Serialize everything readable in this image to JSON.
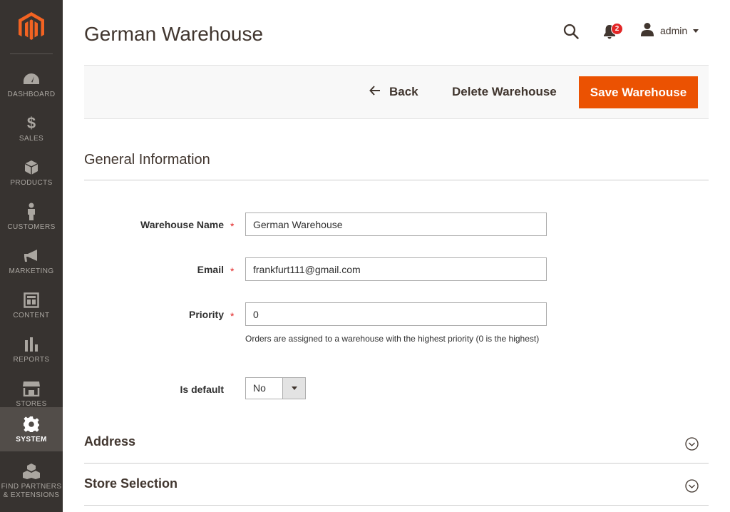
{
  "sidebar": {
    "logo_icon": "magento-logo-icon",
    "items": [
      {
        "label": "DASHBOARD",
        "icon": "dashboard-icon"
      },
      {
        "label": "SALES",
        "icon": "dollar-icon"
      },
      {
        "label": "PRODUCTS",
        "icon": "box-icon"
      },
      {
        "label": "CUSTOMERS",
        "icon": "person-icon"
      },
      {
        "label": "MARKETING",
        "icon": "megaphone-icon"
      },
      {
        "label": "CONTENT",
        "icon": "layout-icon"
      },
      {
        "label": "REPORTS",
        "icon": "bar-chart-icon"
      },
      {
        "label": "STORES",
        "icon": "storefront-icon"
      },
      {
        "label": "SYSTEM",
        "icon": "gear-icon",
        "active": true
      },
      {
        "label_line1": "FIND PARTNERS",
        "label_line2": "& EXTENSIONS",
        "icon": "cubes-icon"
      }
    ]
  },
  "header": {
    "title": "German Warehouse",
    "notifications_count": "2",
    "user_name": "admin"
  },
  "actions": {
    "back_label": "Back",
    "delete_label": "Delete Warehouse",
    "save_label": "Save Warehouse"
  },
  "general": {
    "title": "General Information",
    "fields": {
      "name": {
        "label": "Warehouse Name",
        "value": "German Warehouse",
        "required_mark": "*"
      },
      "email": {
        "label": "Email",
        "value": "frankfurt111@gmail.com",
        "required_mark": "*"
      },
      "priority": {
        "label": "Priority",
        "value": "0",
        "required_mark": "*",
        "note": "Orders are assigned to a warehouse with the highest priority (0 is the highest)"
      },
      "is_default": {
        "label": "Is default",
        "value": "No"
      }
    }
  },
  "sections": {
    "address": "Address",
    "store_selection": "Store Selection"
  },
  "colors": {
    "sidebar_bg": "#373330",
    "sidebar_active": "#524d49",
    "accent": "#eb5202",
    "logo": "#f26322",
    "badge": "#e22626"
  }
}
